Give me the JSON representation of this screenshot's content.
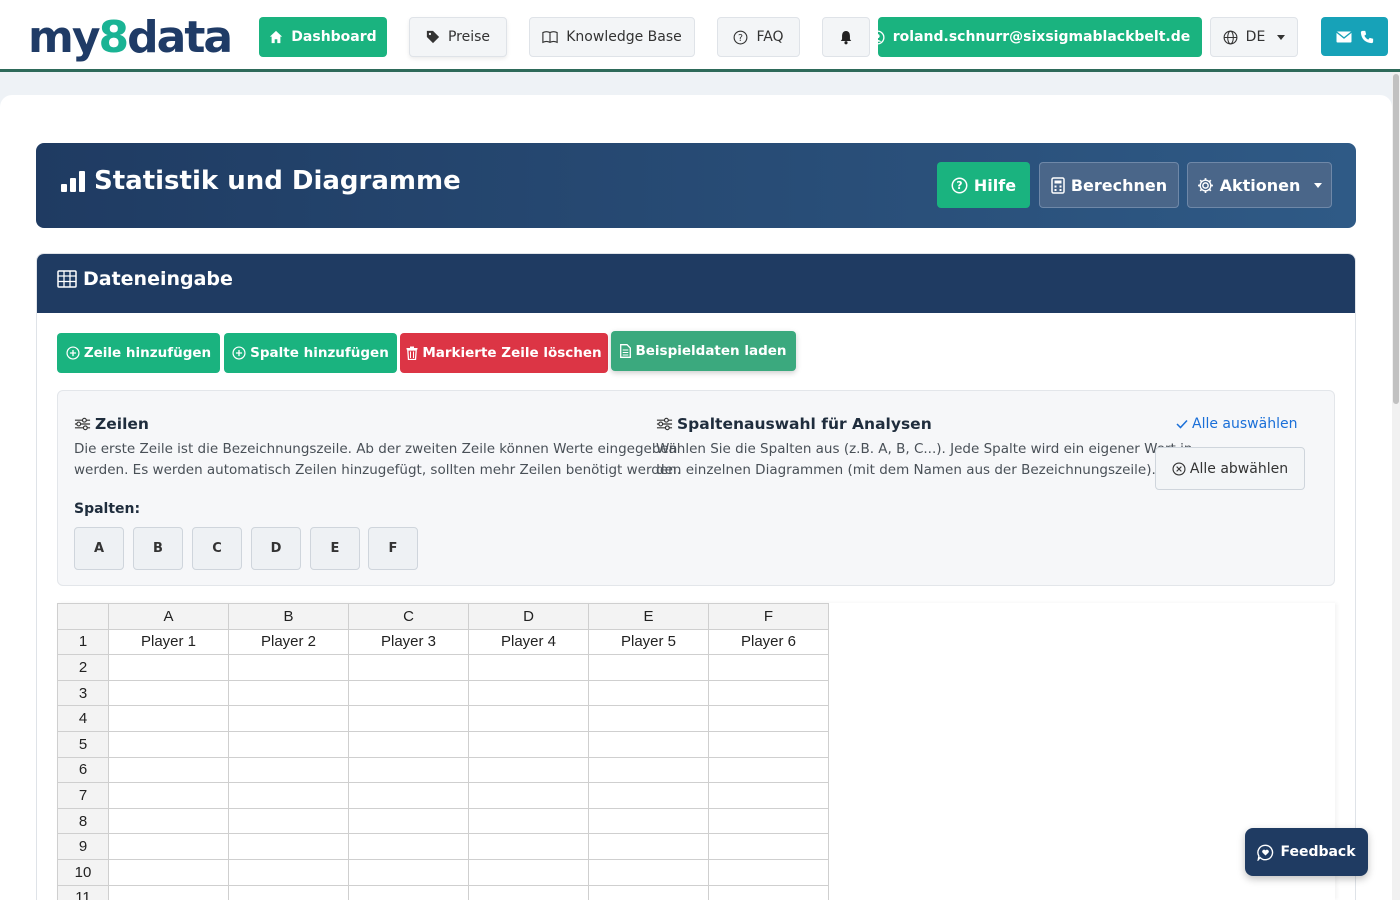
{
  "nav": {
    "logo": {
      "part1": "my",
      "part2": "8",
      "part3": "data"
    },
    "dashboard": "Dashboard",
    "preise": "Preise",
    "knowledge_base": "Knowledge Base",
    "faq": "FAQ",
    "user_email": "roland.schnurr@sixsigmablackbelt.de",
    "language": "DE",
    "icons": {
      "dashboard": "home-icon",
      "preise": "tag-icon",
      "knowledge_base": "book-icon",
      "faq": "question-circle-icon",
      "notifications": "bell-icon",
      "user": "user-circle-icon",
      "language": "globe-icon",
      "contact": "mail-phone-icon"
    }
  },
  "header": {
    "title": "Statistik und Diagramme",
    "hilfe": "Hilfe",
    "berechnen": "Berechnen",
    "aktionen": "Aktionen"
  },
  "dataentry": {
    "title": "Dateneingabe",
    "add_row": "Zeile hinzufügen",
    "add_column": "Spalte hinzufügen",
    "delete_row": "Markierte Zeile löschen",
    "load_example": "Beispieldaten laden",
    "rows_title": "Zeilen",
    "rows_text_1": "Die erste Zeile ist die Bezeichnungszeile. Ab der zweiten Zeile können Werte eingegeben",
    "rows_text_2": "werden. Es werden automatisch Zeilen hinzugefügt, sollten mehr Zeilen benötigt werden.",
    "columns_label": "Spalten:",
    "column_buttons": [
      "A",
      "B",
      "C",
      "D",
      "E",
      "F"
    ],
    "selection_title": "Spaltenauswahl für Analysen",
    "selection_text_1": "Wählen Sie die Spalten aus (z.B. A, B, C...). Jede Spalte wird ein eigener Wert in",
    "selection_text_2": "den einzelnen Diagrammen (mit dem Namen aus der Bezeichnungszeile).",
    "select_all": "Alle auswählen",
    "deselect_all": "Alle abwählen"
  },
  "sheet": {
    "col_headers": [
      "A",
      "B",
      "C",
      "D",
      "E",
      "F"
    ],
    "row_numbers": [
      "1",
      "2",
      "3",
      "4",
      "5",
      "6",
      "7",
      "8",
      "9",
      "10",
      "11"
    ],
    "rows": [
      [
        "Player 1",
        "Player 2",
        "Player 3",
        "Player 4",
        "Player 5",
        "Player 6"
      ],
      [
        "",
        "",
        "",
        "",
        "",
        ""
      ],
      [
        "",
        "",
        "",
        "",
        "",
        ""
      ],
      [
        "",
        "",
        "",
        "",
        "",
        ""
      ],
      [
        "",
        "",
        "",
        "",
        "",
        ""
      ],
      [
        "",
        "",
        "",
        "",
        "",
        ""
      ],
      [
        "",
        "",
        "",
        "",
        "",
        ""
      ],
      [
        "",
        "",
        "",
        "",
        "",
        ""
      ],
      [
        "",
        "",
        "",
        "",
        "",
        ""
      ],
      [
        "",
        "",
        "",
        "",
        "",
        ""
      ],
      [
        "",
        "",
        "",
        "",
        "",
        ""
      ]
    ]
  },
  "feedback": "Feedback",
  "colors": {
    "brand_green": "#1ab37f",
    "navy": "#1f3b62",
    "danger": "#dc3545",
    "link": "#1a6fd8"
  }
}
